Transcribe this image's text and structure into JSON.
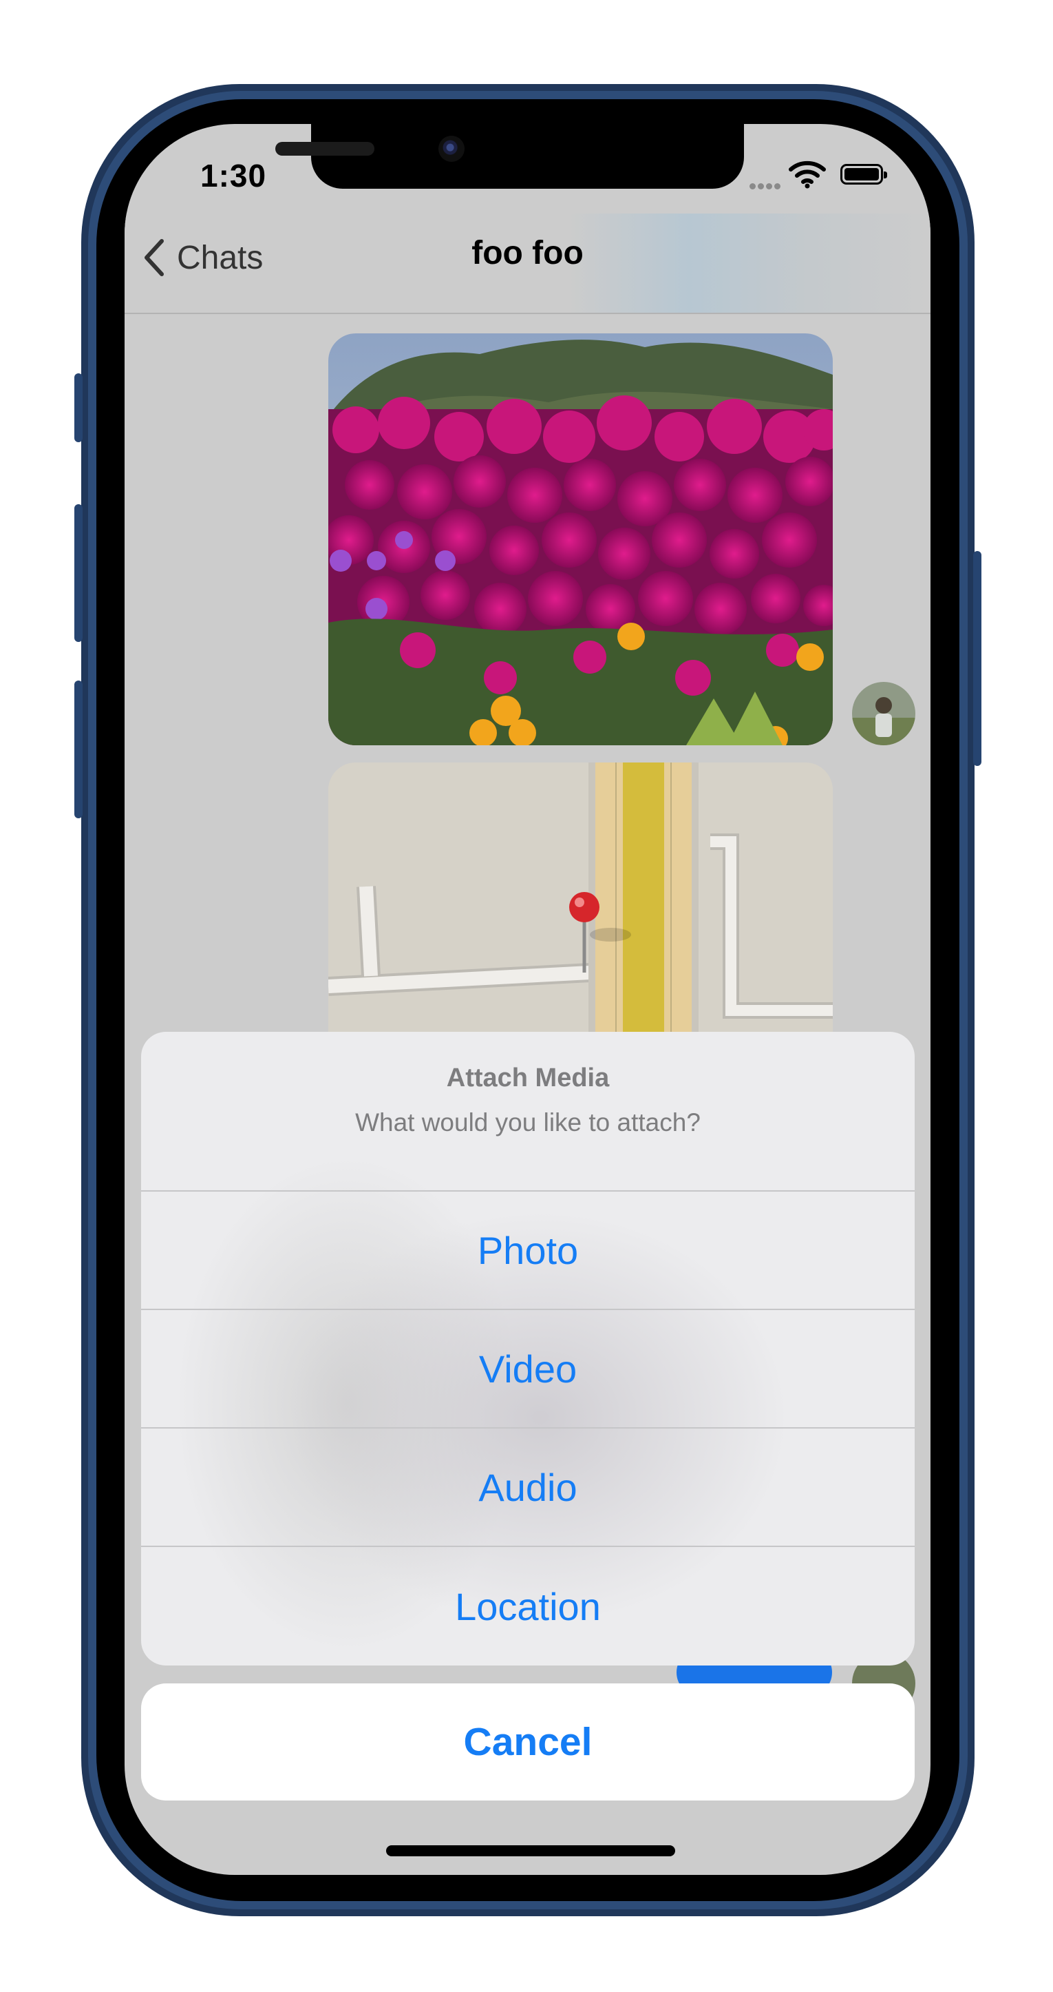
{
  "status_bar": {
    "time": "1:30",
    "signal_icon": "cellular-dots-icon",
    "wifi_icon": "wifi-icon",
    "battery_icon": "battery-icon"
  },
  "nav": {
    "back_label": "Chats",
    "back_icon": "chevron-left-icon",
    "title": "foo foo"
  },
  "messages": [
    {
      "kind": "image",
      "description": "photo-message"
    },
    {
      "kind": "location",
      "description": "map-message"
    }
  ],
  "action_sheet": {
    "title": "Attach Media",
    "message": "What would you like to attach?",
    "actions": [
      "Photo",
      "Video",
      "Audio",
      "Location"
    ],
    "cancel_label": "Cancel"
  },
  "colors": {
    "accent": "#157df5",
    "device": "#2d4c78",
    "bubble": "#1a74e8"
  }
}
